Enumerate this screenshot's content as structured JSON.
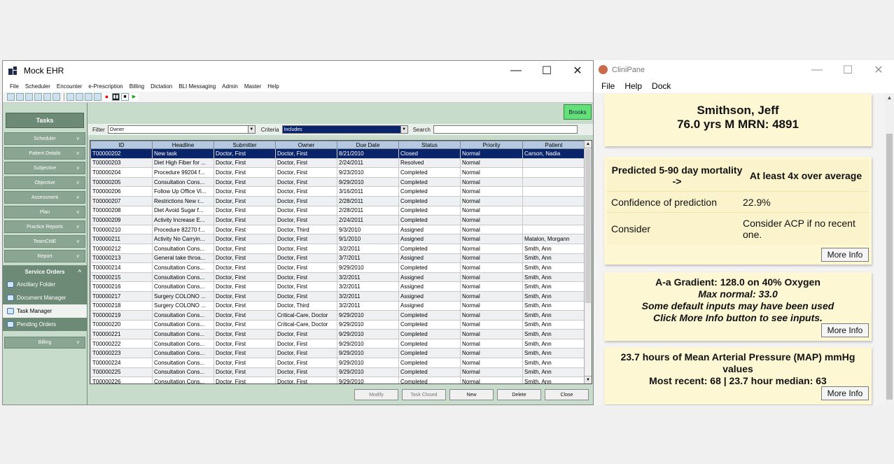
{
  "ehr": {
    "title": "Mock EHR",
    "menu": [
      "File",
      "Scheduler",
      "Encounter",
      "e-Prescription",
      "Billing",
      "Dictation",
      "BLI Messaging",
      "Admin",
      "Master",
      "Help"
    ],
    "sidebar": {
      "tasks_header": "Tasks",
      "sections": [
        "Scheduler",
        "Patient Details",
        "Subjective",
        "Objective",
        "Assessment",
        "Plan",
        "Practice Reports",
        "TeamCME",
        "Report"
      ],
      "service_orders": {
        "header": "Service Orders",
        "items": [
          "Ancillary Folder",
          "Document Manager",
          "Task Manager",
          "Pending Orders"
        ]
      },
      "billing": "Billing"
    },
    "user_badge": "Brooks",
    "filter": {
      "filter_label": "Filter",
      "filter_value": "Owner",
      "criteria_label": "Criteria",
      "criteria_value": "Includes",
      "search_label": "Search",
      "search_value": ""
    },
    "grid": {
      "columns": [
        "ID",
        "Headline",
        "Submitter",
        "Owner",
        "Due Date",
        "Status",
        "Priority",
        "Patient"
      ],
      "rows": [
        [
          "T00000202",
          "New task",
          "Doctor, First",
          "Doctor, First",
          "8/21/2010",
          "Closed",
          "Normal",
          "Carson, Nadia"
        ],
        [
          "T00000203",
          "Diet High Fiber for ...",
          "Doctor, First",
          "Doctor, First",
          "2/24/2011",
          "Resolved",
          "Normal",
          ""
        ],
        [
          "T00000204",
          "Procedure 99204 f...",
          "Doctor, First",
          "Doctor, First",
          "9/23/2010",
          "Completed",
          "Normal",
          ""
        ],
        [
          "T00000205",
          "Consultation Cons...",
          "Doctor, First",
          "Doctor, First",
          "9/29/2010",
          "Completed",
          "Normal",
          ""
        ],
        [
          "T00000206",
          "Follow Up Office Vi...",
          "Doctor, First",
          "Doctor, First",
          "3/16/2011",
          "Completed",
          "Normal",
          ""
        ],
        [
          "T00000207",
          "Restrictions New r...",
          "Doctor, First",
          "Doctor, First",
          "2/28/2011",
          "Completed",
          "Normal",
          ""
        ],
        [
          "T00000208",
          "Diet Avoid Sugar f...",
          "Doctor, First",
          "Doctor, First",
          "2/28/2011",
          "Completed",
          "Normal",
          ""
        ],
        [
          "T00000209",
          "Activity Increase E...",
          "Doctor, First",
          "Doctor, First",
          "2/24/2011",
          "Completed",
          "Normal",
          ""
        ],
        [
          "T00000210",
          "Procedure 82270 f...",
          "Doctor, First",
          "Doctor, Third",
          "9/3/2010",
          "Assigned",
          "Normal",
          ""
        ],
        [
          "T00000211",
          "Activity No Carryin...",
          "Doctor, First",
          "Doctor, First",
          "9/1/2010",
          "Assigned",
          "Normal",
          "Matalon, Morgann"
        ],
        [
          "T00000212",
          "Consultation Cons...",
          "Doctor, First",
          "Doctor, First",
          "3/2/2011",
          "Completed",
          "Normal",
          "Smith, Ann"
        ],
        [
          "T00000213",
          "General take throa...",
          "Doctor, First",
          "Doctor, First",
          "3/7/2011",
          "Assigned",
          "Normal",
          "Smith, Ann"
        ],
        [
          "T00000214",
          "Consultation Cons...",
          "Doctor, First",
          "Doctor, First",
          "9/29/2010",
          "Completed",
          "Normal",
          "Smith, Ann"
        ],
        [
          "T00000215",
          "Consultation Cons...",
          "Doctor, First",
          "Doctor, First",
          "3/2/2011",
          "Assigned",
          "Normal",
          "Smith, Ann"
        ],
        [
          "T00000216",
          "Consultation Cons...",
          "Doctor, First",
          "Doctor, First",
          "3/2/2011",
          "Assigned",
          "Normal",
          "Smith, Ann"
        ],
        [
          "T00000217",
          "Surgery COLONO ...",
          "Doctor, First",
          "Doctor, First",
          "3/2/2011",
          "Assigned",
          "Normal",
          "Smith, Ann"
        ],
        [
          "T00000218",
          "Surgery COLONO ...",
          "Doctor, First",
          "Doctor, Third",
          "3/2/2011",
          "Assigned",
          "Normal",
          "Smith, Ann"
        ],
        [
          "T00000219",
          "Consultation Cons...",
          "Doctor, First",
          "Critical-Care, Doctor",
          "9/29/2010",
          "Completed",
          "Normal",
          "Smith, Ann"
        ],
        [
          "T00000220",
          "Consultation Cons...",
          "Doctor, First",
          "Critical-Care, Doctor",
          "9/29/2010",
          "Completed",
          "Normal",
          "Smith, Ann"
        ],
        [
          "T00000221",
          "Consultation Cons...",
          "Doctor, First",
          "Doctor, First",
          "9/29/2010",
          "Completed",
          "Normal",
          "Smith, Ann"
        ],
        [
          "T00000222",
          "Consultation Cons...",
          "Doctor, First",
          "Doctor, First",
          "9/29/2010",
          "Completed",
          "Normal",
          "Smith, Ann"
        ],
        [
          "T00000223",
          "Consultation Cons...",
          "Doctor, First",
          "Doctor, First",
          "9/29/2010",
          "Completed",
          "Normal",
          "Smith, Ann"
        ],
        [
          "T00000224",
          "Consultation Cons...",
          "Doctor, First",
          "Doctor, First",
          "9/29/2010",
          "Completed",
          "Normal",
          "Smith, Ann"
        ],
        [
          "T00000225",
          "Consultation Cons...",
          "Doctor, First",
          "Doctor, First",
          "9/29/2010",
          "Completed",
          "Normal",
          "Smith, Ann"
        ],
        [
          "T00000226",
          "Consultation Cons...",
          "Doctor, First",
          "Doctor, First",
          "9/29/2010",
          "Completed",
          "Normal",
          "Smith, Ann"
        ]
      ]
    },
    "buttons": {
      "modify": "Modify",
      "task_closed": "Task Closed",
      "new": "New",
      "delete": "Delete",
      "close": "Close"
    }
  },
  "clinipane": {
    "title": "CliniPane",
    "menu": [
      "File",
      "Help",
      "Dock"
    ],
    "patient": {
      "name": "Smithson, Jeff",
      "summary": "76.0 yrs M MRN: 4891"
    },
    "mortality": {
      "header_left": "Predicted 5-90 day mortality ->",
      "header_right": "At least 4x over average",
      "confidence_label": "Confidence of prediction",
      "confidence_value": "22.9%",
      "consider_label": "Consider",
      "consider_value": "Consider ACP if no recent one.",
      "more_info": "More Info"
    },
    "gradient": {
      "line1": "A-a Gradient: 128.0 on 40% Oxygen",
      "line2": "Max normal: 33.0",
      "line3": "Some default inputs may have been used",
      "line4": "Click More Info button to see inputs.",
      "more_info": "More Info"
    },
    "map": {
      "line1": "23.7 hours of Mean Arterial Pressure (MAP) mmHg values",
      "line2": "Most recent: 68 | 23.7 hour median: 63",
      "more_info": "More Info"
    }
  },
  "colors": {
    "sidebar_bg": "#c7dccb",
    "sidebar_dark": "#6c8a75",
    "selection": "#0a246a",
    "card_bg": "#fdf7d3",
    "brooks_badge": "#64e07a"
  }
}
